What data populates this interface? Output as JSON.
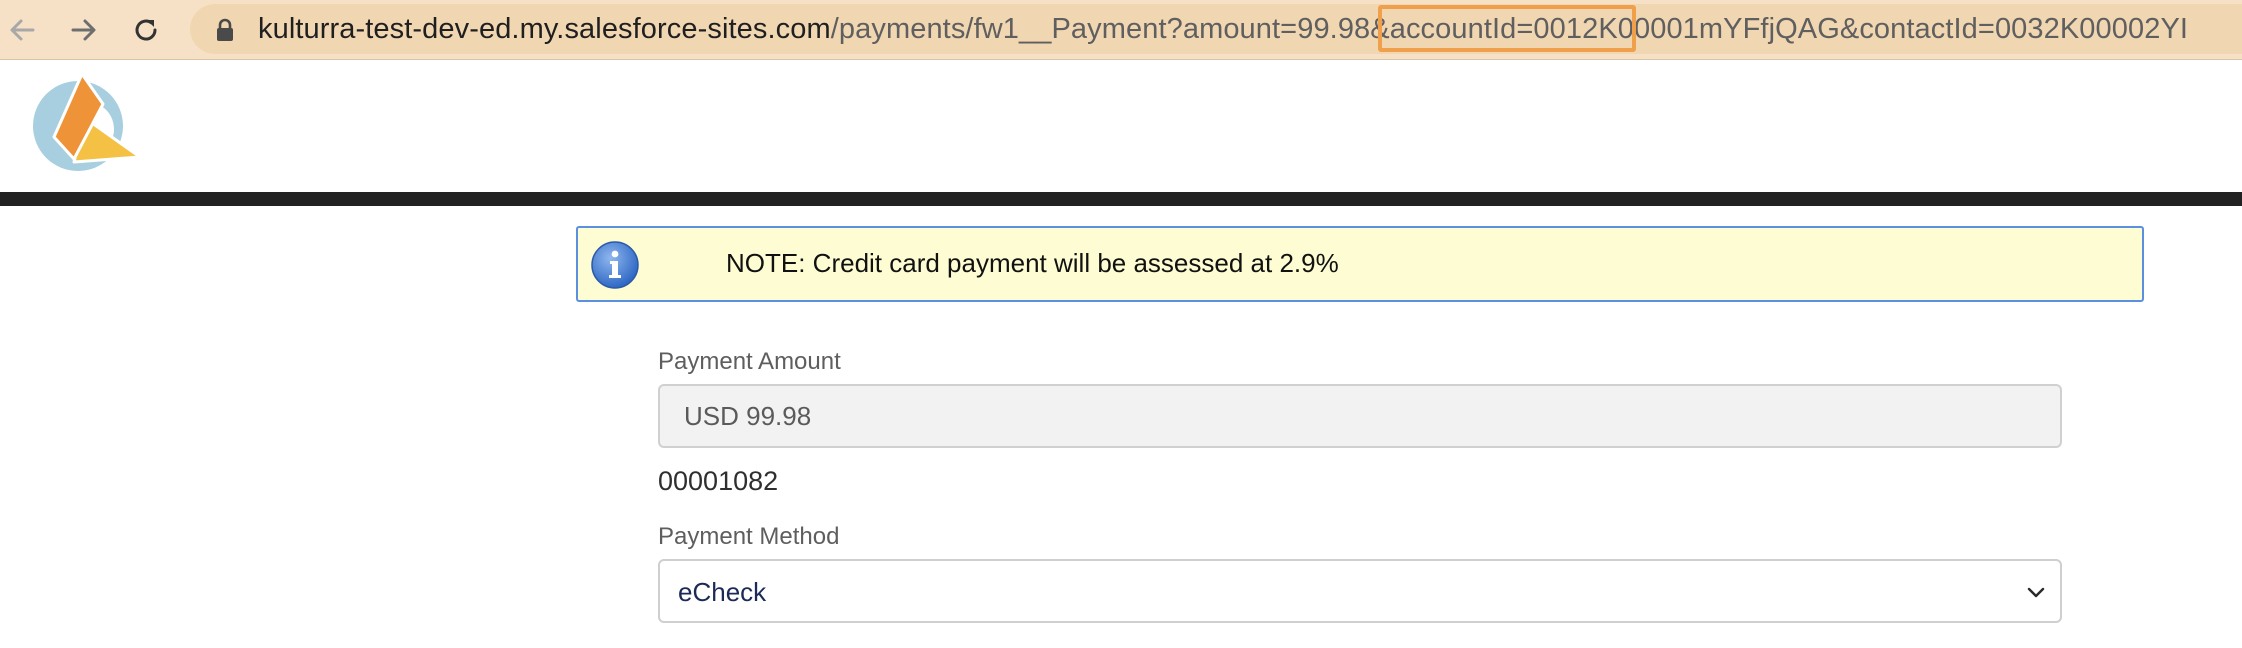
{
  "browser": {
    "url_host": "kulturra-test-dev-ed.my.salesforce-sites.com",
    "url_path": "/payments/fw1__Payment?amount=99.98&accountId=0012K00001mYFfjQAG&contactId=0032K00002YI",
    "highlight_color": "#f0a04b"
  },
  "icons": {
    "back": "arrow-left-icon",
    "forward": "arrow-right-icon",
    "reload": "reload-icon",
    "lock": "lock-icon",
    "info": "info-icon",
    "chevron": "chevron-down-icon"
  },
  "note": {
    "text": "NOTE: Credit card payment will be assessed at 2.9%",
    "background": "#fdfcd2",
    "border": "#5b8fe0"
  },
  "form": {
    "amount_label": "Payment Amount",
    "amount_value": "USD 99.98",
    "record_number": "00001082",
    "method_label": "Payment Method",
    "method_value": "eCheck"
  }
}
